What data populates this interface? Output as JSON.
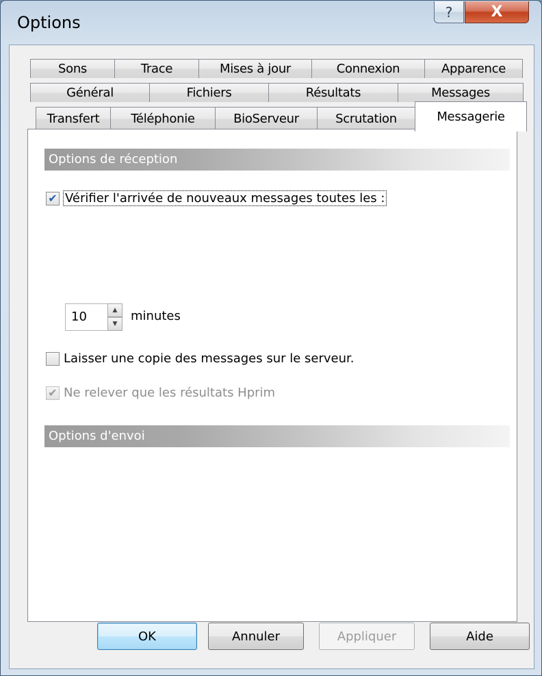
{
  "window": {
    "title": "Options",
    "help_glyph": "?",
    "close_glyph": "X"
  },
  "tabs": {
    "row1": [
      "Sons",
      "Trace",
      "Mises à jour",
      "Connexion",
      "Apparence"
    ],
    "row2": [
      "Général",
      "Fichiers",
      "Résultats",
      "Messages"
    ],
    "row3": [
      "Transfert",
      "Téléphonie",
      "BioServeur",
      "Scrutation"
    ],
    "active": "Messagerie"
  },
  "reception": {
    "header": "Options de réception",
    "check_new_label": "Vérifier l'arrivée de nouveaux messages toutes les :",
    "check_new_checked": true,
    "interval_value": "10",
    "interval_unit": "minutes",
    "leave_copy_label": "Laisser une copie des messages sur le serveur.",
    "leave_copy_checked": false,
    "hprim_label": "Ne relever que les résultats Hprim",
    "hprim_checked": true
  },
  "sending": {
    "header": "Options d'envoi"
  },
  "buttons": {
    "ok": "OK",
    "cancel": "Annuler",
    "apply": "Appliquer",
    "help": "Aide"
  },
  "icons": {
    "check": "checkmark-icon",
    "spin_up": "chevron-up-icon",
    "spin_down": "chevron-down-icon"
  }
}
